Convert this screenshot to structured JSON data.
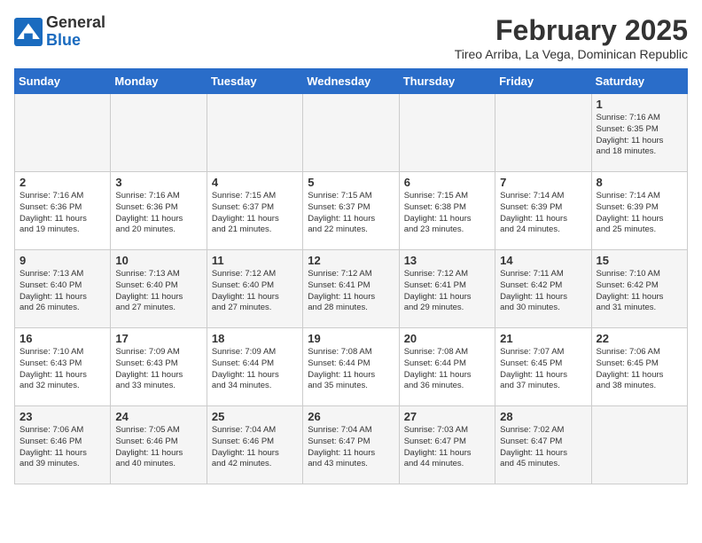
{
  "header": {
    "logo_general": "General",
    "logo_blue": "Blue",
    "month_title": "February 2025",
    "subtitle": "Tireo Arriba, La Vega, Dominican Republic"
  },
  "days_of_week": [
    "Sunday",
    "Monday",
    "Tuesday",
    "Wednesday",
    "Thursday",
    "Friday",
    "Saturday"
  ],
  "weeks": [
    [
      {
        "day": "",
        "info": ""
      },
      {
        "day": "",
        "info": ""
      },
      {
        "day": "",
        "info": ""
      },
      {
        "day": "",
        "info": ""
      },
      {
        "day": "",
        "info": ""
      },
      {
        "day": "",
        "info": ""
      },
      {
        "day": "1",
        "info": "Sunrise: 7:16 AM\nSunset: 6:35 PM\nDaylight: 11 hours\nand 18 minutes."
      }
    ],
    [
      {
        "day": "2",
        "info": "Sunrise: 7:16 AM\nSunset: 6:36 PM\nDaylight: 11 hours\nand 19 minutes."
      },
      {
        "day": "3",
        "info": "Sunrise: 7:16 AM\nSunset: 6:36 PM\nDaylight: 11 hours\nand 20 minutes."
      },
      {
        "day": "4",
        "info": "Sunrise: 7:15 AM\nSunset: 6:37 PM\nDaylight: 11 hours\nand 21 minutes."
      },
      {
        "day": "5",
        "info": "Sunrise: 7:15 AM\nSunset: 6:37 PM\nDaylight: 11 hours\nand 22 minutes."
      },
      {
        "day": "6",
        "info": "Sunrise: 7:15 AM\nSunset: 6:38 PM\nDaylight: 11 hours\nand 23 minutes."
      },
      {
        "day": "7",
        "info": "Sunrise: 7:14 AM\nSunset: 6:39 PM\nDaylight: 11 hours\nand 24 minutes."
      },
      {
        "day": "8",
        "info": "Sunrise: 7:14 AM\nSunset: 6:39 PM\nDaylight: 11 hours\nand 25 minutes."
      }
    ],
    [
      {
        "day": "9",
        "info": "Sunrise: 7:13 AM\nSunset: 6:40 PM\nDaylight: 11 hours\nand 26 minutes."
      },
      {
        "day": "10",
        "info": "Sunrise: 7:13 AM\nSunset: 6:40 PM\nDaylight: 11 hours\nand 27 minutes."
      },
      {
        "day": "11",
        "info": "Sunrise: 7:12 AM\nSunset: 6:40 PM\nDaylight: 11 hours\nand 27 minutes."
      },
      {
        "day": "12",
        "info": "Sunrise: 7:12 AM\nSunset: 6:41 PM\nDaylight: 11 hours\nand 28 minutes."
      },
      {
        "day": "13",
        "info": "Sunrise: 7:12 AM\nSunset: 6:41 PM\nDaylight: 11 hours\nand 29 minutes."
      },
      {
        "day": "14",
        "info": "Sunrise: 7:11 AM\nSunset: 6:42 PM\nDaylight: 11 hours\nand 30 minutes."
      },
      {
        "day": "15",
        "info": "Sunrise: 7:10 AM\nSunset: 6:42 PM\nDaylight: 11 hours\nand 31 minutes."
      }
    ],
    [
      {
        "day": "16",
        "info": "Sunrise: 7:10 AM\nSunset: 6:43 PM\nDaylight: 11 hours\nand 32 minutes."
      },
      {
        "day": "17",
        "info": "Sunrise: 7:09 AM\nSunset: 6:43 PM\nDaylight: 11 hours\nand 33 minutes."
      },
      {
        "day": "18",
        "info": "Sunrise: 7:09 AM\nSunset: 6:44 PM\nDaylight: 11 hours\nand 34 minutes."
      },
      {
        "day": "19",
        "info": "Sunrise: 7:08 AM\nSunset: 6:44 PM\nDaylight: 11 hours\nand 35 minutes."
      },
      {
        "day": "20",
        "info": "Sunrise: 7:08 AM\nSunset: 6:44 PM\nDaylight: 11 hours\nand 36 minutes."
      },
      {
        "day": "21",
        "info": "Sunrise: 7:07 AM\nSunset: 6:45 PM\nDaylight: 11 hours\nand 37 minutes."
      },
      {
        "day": "22",
        "info": "Sunrise: 7:06 AM\nSunset: 6:45 PM\nDaylight: 11 hours\nand 38 minutes."
      }
    ],
    [
      {
        "day": "23",
        "info": "Sunrise: 7:06 AM\nSunset: 6:46 PM\nDaylight: 11 hours\nand 39 minutes."
      },
      {
        "day": "24",
        "info": "Sunrise: 7:05 AM\nSunset: 6:46 PM\nDaylight: 11 hours\nand 40 minutes."
      },
      {
        "day": "25",
        "info": "Sunrise: 7:04 AM\nSunset: 6:46 PM\nDaylight: 11 hours\nand 42 minutes."
      },
      {
        "day": "26",
        "info": "Sunrise: 7:04 AM\nSunset: 6:47 PM\nDaylight: 11 hours\nand 43 minutes."
      },
      {
        "day": "27",
        "info": "Sunrise: 7:03 AM\nSunset: 6:47 PM\nDaylight: 11 hours\nand 44 minutes."
      },
      {
        "day": "28",
        "info": "Sunrise: 7:02 AM\nSunset: 6:47 PM\nDaylight: 11 hours\nand 45 minutes."
      },
      {
        "day": "",
        "info": ""
      }
    ]
  ]
}
